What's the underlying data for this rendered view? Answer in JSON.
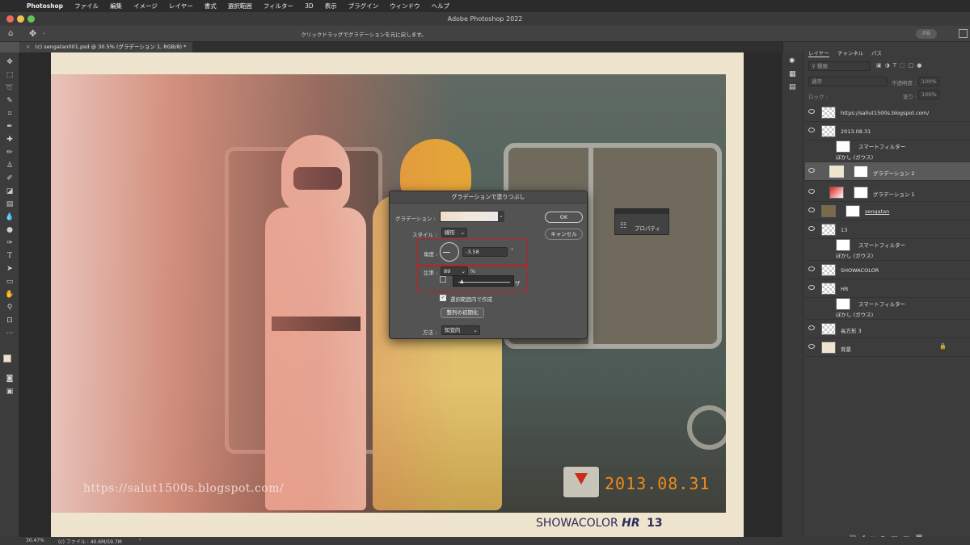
{
  "menubar": {
    "apple": "",
    "app": "Photoshop",
    "items": [
      "ファイル",
      "編集",
      "イメージ",
      "レイヤー",
      "書式",
      "選択範囲",
      "フィルター",
      "3D",
      "表示",
      "プラグイン",
      "ウィンドウ",
      "ヘルプ"
    ]
  },
  "window": {
    "title": "Adobe Photoshop 2022"
  },
  "options": {
    "hint": "クリックドラッグでグラデーションを元に戻します。",
    "share": "共有"
  },
  "doc_tab": {
    "label": "(c) sengatan001.psd @ 30.5% (グラデーション 1, RGB/8) *"
  },
  "photo": {
    "watermark": "https://salut1500s.blogspot.com/",
    "date_stamp": "2013.08.31",
    "caption_a": "SHOWACOLOR",
    "caption_b": "HR",
    "caption_c": "13"
  },
  "dialog": {
    "title": "グラデーションで塗りつぶし",
    "gradient_label": "グラデーション :",
    "style_label": "スタイル :",
    "style_value": "線形",
    "angle_label": "角度 :",
    "angle_value": "-3.58",
    "angle_unit": "°",
    "scale_label": "比率 :",
    "scale_value": "89",
    "scale_unit": "%",
    "ok": "OK",
    "cancel": "キャンセル",
    "within_selection": "選択範囲内で作成",
    "reset_align": "整列の初期化",
    "method_label": "方法 :",
    "method_value": "知覚的"
  },
  "properties_panel": {
    "label": "プロパティ"
  },
  "layers_panel": {
    "tabs": [
      "レイヤー",
      "チャンネル",
      "パス"
    ],
    "filter_kind": "種類",
    "blend_mode": "通常",
    "opacity_label": "不透明度 :",
    "opacity_value": "100%",
    "lock_label": "ロック :",
    "fill_label": "塗り :",
    "fill_value": "100%",
    "layers": [
      {
        "name": "https://saliut1500s.blogspot.com/"
      },
      {
        "name": "2013.08.31"
      },
      {
        "name": "スマートフィルター"
      },
      {
        "name": "ぼかし (ガウス)"
      },
      {
        "name": "グラデーション 2"
      },
      {
        "name": "グラデーション 1"
      },
      {
        "name": "sengatan"
      },
      {
        "name": "13"
      },
      {
        "name": "スマートフィルター"
      },
      {
        "name": "ぼかし (ガウス)"
      },
      {
        "name": "SHOWACOLOR"
      },
      {
        "name": "HR"
      },
      {
        "name": "スマートフィルター"
      },
      {
        "name": "ぼかし (ガウス)"
      },
      {
        "name": "長方形 3"
      },
      {
        "name": "背景"
      }
    ]
  },
  "status": {
    "zoom": "30.47%",
    "file": "(c) ファイル : 40.6M/59.7M"
  },
  "colors": {
    "accent_red": "#c02020",
    "bg_beige": "#efe5cf"
  }
}
